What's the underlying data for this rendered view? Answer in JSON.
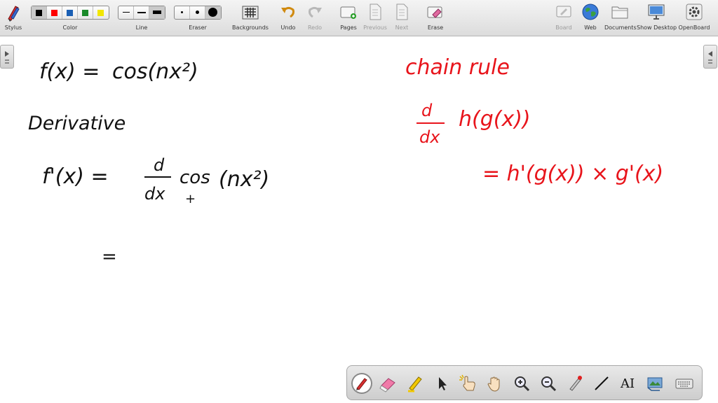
{
  "toolbar": {
    "stylus": "Stylus",
    "color": "Color",
    "line": "Line",
    "eraser": "Eraser",
    "backgrounds": "Backgrounds",
    "undo": "Undo",
    "redo": "Redo",
    "pages": "Pages",
    "previous": "Previous",
    "next": "Next",
    "erase": "Erase",
    "board": "Board",
    "web": "Web",
    "documents": "Documents",
    "show_desktop": "Show Desktop",
    "openboard": "OpenBoard"
  },
  "colors": {
    "swatches": [
      "#000000",
      "#ff0000",
      "#1a5fb4",
      "#1a8a2a",
      "#f2e600"
    ],
    "ink_black": "#111111",
    "ink_red": "#e8141b"
  },
  "handwriting": {
    "f_x": "f(x) =",
    "cos_nx2": "cos(nx²)",
    "derivative": "Derivative",
    "f_prime": "f'(x) =",
    "d_dx_num": "d",
    "d_dx_den": "dx",
    "cos_term": "cos",
    "paren_nx2": "(nx²)",
    "plus_mark": "+",
    "equals_alone": "=",
    "chain_rule": "chain rule",
    "d2": "d",
    "dx2": "dx",
    "h_gx": "h(g(x))",
    "chain_result": "= h'(g(x)) × g'(x)"
  },
  "dock": {
    "text_tool": "AI"
  }
}
